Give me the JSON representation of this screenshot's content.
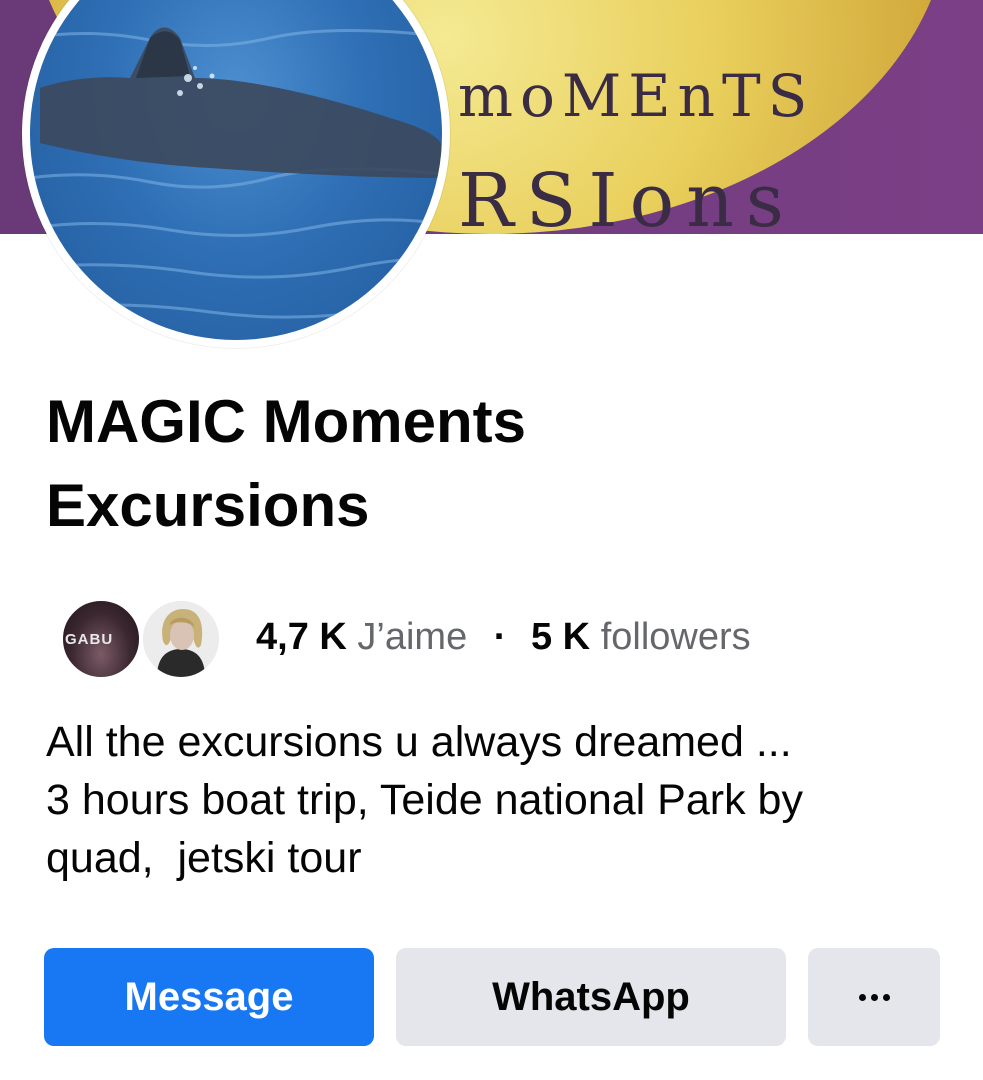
{
  "cover": {
    "line_1": "moMEnTS",
    "line_2": "RSIons"
  },
  "page": {
    "title_line_1": "MAGIC Moments",
    "title_line_2": "Excursions"
  },
  "stats": {
    "friend_avatar_1_text": "GABU",
    "likes_count": "4,7 K",
    "likes_label": "J’aime",
    "separator": "·",
    "followers_count": "5 K",
    "followers_label": "followers"
  },
  "description": {
    "line_1": "All the excursions u always dreamed ...",
    "line_2": "3 hours boat trip, Teide national Park by",
    "line_3": "quad,  jetski tour"
  },
  "actions": {
    "message_label": "Message",
    "whatsapp_label": "WhatsApp",
    "more_icon": "more-dots-icon"
  },
  "colors": {
    "primary_blue": "#1877f2",
    "secondary_button": "#e4e6eb",
    "text_primary": "#050505",
    "text_secondary": "#65676b",
    "cover_purple": "#7b3f86",
    "cover_gold": "#e9cf5c"
  }
}
